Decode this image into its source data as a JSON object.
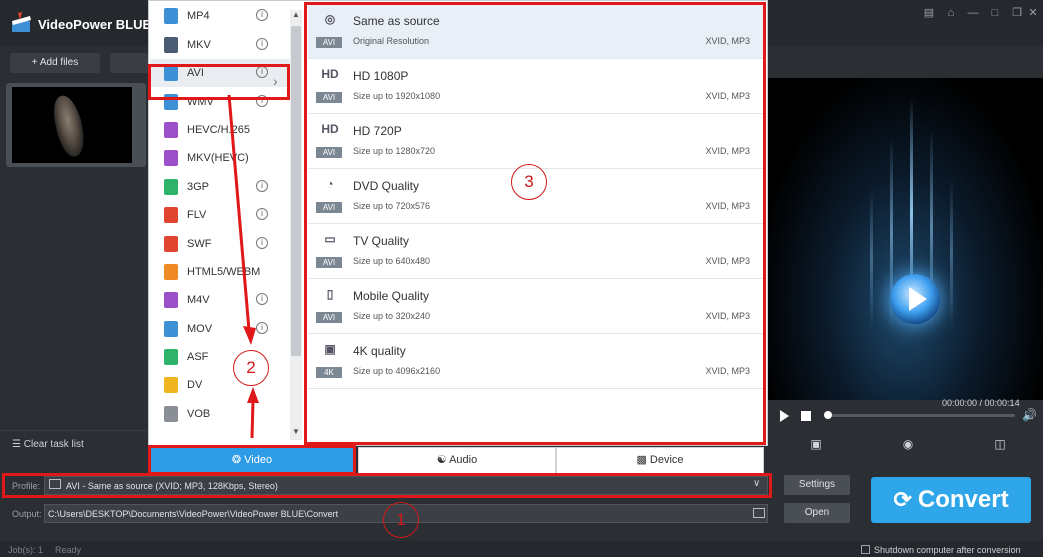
{
  "window": {
    "title": "VideoPower BLUE",
    "controls": [
      "🛒",
      "⌂",
      "—",
      "□",
      "✕"
    ]
  },
  "toolbar": {
    "add_files": "Add files"
  },
  "left_panel": {
    "clear_task_list": "Clear task list"
  },
  "formats": [
    {
      "name": "MP4",
      "color": "#3d8fd6",
      "info": true
    },
    {
      "name": "MKV",
      "color": "#4a5c74",
      "info": true
    },
    {
      "name": "AVI",
      "color": "#3d8fd6",
      "info": true,
      "selected": true
    },
    {
      "name": "WMV",
      "color": "#3d8fd6",
      "info": true
    },
    {
      "name": "HEVC/H.265",
      "color": "#9b4fc8",
      "info": false
    },
    {
      "name": "MKV(HEVC)",
      "color": "#9b4fc8",
      "info": false
    },
    {
      "name": "3GP",
      "color": "#2fb36a",
      "info": true
    },
    {
      "name": "FLV",
      "color": "#e0452f",
      "info": true
    },
    {
      "name": "SWF",
      "color": "#e0452f",
      "info": true
    },
    {
      "name": "HTML5/WEBM",
      "color": "#f08a24",
      "info": false
    },
    {
      "name": "M4V",
      "color": "#9b4fc8",
      "info": true
    },
    {
      "name": "MOV",
      "color": "#3d8fd6",
      "info": true
    },
    {
      "name": "ASF",
      "color": "#2fb36a",
      "info": false
    },
    {
      "name": "DV",
      "color": "#f0b420",
      "info": false
    },
    {
      "name": "VOB",
      "color": "#8a8f96",
      "info": false
    }
  ],
  "presets": [
    {
      "name": "Same as source",
      "resolution": "Original Resolution",
      "codec": "XVID, MP3",
      "tag": "AVI",
      "icon": "◎"
    },
    {
      "name": "HD 1080P",
      "resolution": "Size up to 1920x1080",
      "codec": "XVID, MP3",
      "tag": "AVI",
      "icon": "HD"
    },
    {
      "name": "HD 720P",
      "resolution": "Size up to 1280x720",
      "codec": "XVID, MP3",
      "tag": "AVI",
      "icon": "HD"
    },
    {
      "name": "DVD Quality",
      "resolution": "Size up to 720x576",
      "codec": "XVID, MP3",
      "tag": "AVI",
      "icon": "◔"
    },
    {
      "name": "TV Quality",
      "resolution": "Size up to 640x480",
      "codec": "XVID, MP3",
      "tag": "AVI",
      "icon": "▭"
    },
    {
      "name": "Mobile Quality",
      "resolution": "Size up to 320x240",
      "codec": "XVID, MP3",
      "tag": "AVI",
      "icon": "▯"
    },
    {
      "name": "4K quality",
      "resolution": "Size up to 4096x2160",
      "codec": "XVID, MP3",
      "tag": "4K",
      "icon": "▣"
    }
  ],
  "tabs": {
    "video": "Video",
    "audio": "Audio",
    "device": "Device"
  },
  "profile": {
    "label": "Profile:",
    "value": "AVI - Same as source (XVID; MP3, 128Kbps, Stereo)"
  },
  "output": {
    "label": "Output:",
    "value": "C:\\Users\\DESKTOP\\Documents\\VideoPower\\VideoPower BLUE\\Convert"
  },
  "buttons": {
    "settings": "Settings",
    "open": "Open",
    "convert": "Convert"
  },
  "player": {
    "time": "00:00:00 / 00:00:14"
  },
  "status": {
    "jobs": "Job(s): 1",
    "ready": "Ready",
    "shutdown": "Shutdown computer after conversion"
  },
  "annotations": {
    "one": "1",
    "two": "2",
    "three": "3"
  }
}
